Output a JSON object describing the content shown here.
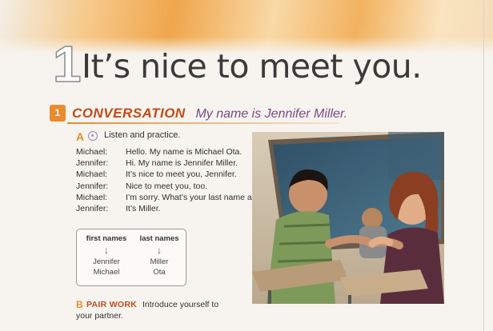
{
  "unit": {
    "number": "1",
    "title": "It’s nice to meet you."
  },
  "section": {
    "number": "1",
    "label": "CONVERSATION",
    "subtitle": "My name is Jennifer Miller."
  },
  "part_a": {
    "letter": "A",
    "instruction": "Listen and practice."
  },
  "conversation": [
    {
      "speaker": "Michael:",
      "line": "Hello. My name is Michael Ota."
    },
    {
      "speaker": "Jennifer:",
      "line": "Hi. My name is Jennifer Miller."
    },
    {
      "speaker": "Michael:",
      "line": "It’s nice to meet you, Jennifer."
    },
    {
      "speaker": "Jennifer:",
      "line": "Nice to meet you, too."
    },
    {
      "speaker": "Michael:",
      "line": "I’m sorry. What’s your last name again?"
    },
    {
      "speaker": "Jennifer:",
      "line": "It’s Miller."
    }
  ],
  "names_box": {
    "first_header": "first names",
    "last_header": "last names",
    "arrow": "↓",
    "first_values": [
      "Jennifer",
      "Michael"
    ],
    "last_values": [
      "Miller",
      "Ota"
    ]
  },
  "part_b": {
    "letter": "B",
    "label": "PAIR WORK",
    "text_line1": "Introduce yourself to",
    "text_line2": "your partner."
  },
  "colors": {
    "accent_orange": "#e98b2e",
    "heading_red": "#c44a1a",
    "subtitle_purple": "#7a4a8a"
  },
  "icons": {
    "audio": "audio-icon"
  }
}
